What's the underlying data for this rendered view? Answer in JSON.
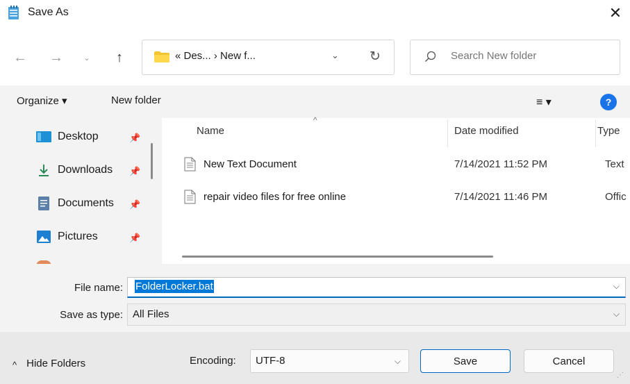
{
  "window": {
    "title": "Save As",
    "close_label": "✕"
  },
  "nav": {
    "back": "←",
    "forward": "→",
    "recent": "⌄",
    "up": "↑",
    "address_text": "«  Des...  ›  New f...",
    "address_drop": "⌄",
    "refresh": "↻",
    "search_placeholder": "Search New folder"
  },
  "toolbar": {
    "organize_label": "Organize ▾",
    "new_folder_label": "New folder",
    "view_label": "≡ ▾",
    "help_label": "?"
  },
  "sidebar": {
    "items": [
      {
        "label": "Desktop",
        "icon": "desktop-icon"
      },
      {
        "label": "Downloads",
        "icon": "downloads-icon"
      },
      {
        "label": "Documents",
        "icon": "documents-icon"
      },
      {
        "label": "Pictures",
        "icon": "pictures-icon"
      }
    ],
    "pin": "📌"
  },
  "files": {
    "columns": {
      "name": "Name",
      "date": "Date modified",
      "type": "Type"
    },
    "sort_indicator": "^",
    "rows": [
      {
        "name": "New Text Document",
        "date": "7/14/2021 11:52 PM",
        "type": "Text"
      },
      {
        "name": "repair video files for free online",
        "date": "7/14/2021 11:46 PM",
        "type": "Offic"
      }
    ]
  },
  "form": {
    "filename_label": "File name:",
    "filename_value": "FolderLocker.bat",
    "type_label": "Save as type:",
    "type_value": "All Files",
    "drop": "⌵"
  },
  "footer": {
    "hide_folders_label": "Hide Folders",
    "hide_chevron": "^",
    "encoding_label": "Encoding:",
    "encoding_value": "UTF-8",
    "save_label": "Save",
    "cancel_label": "Cancel"
  }
}
